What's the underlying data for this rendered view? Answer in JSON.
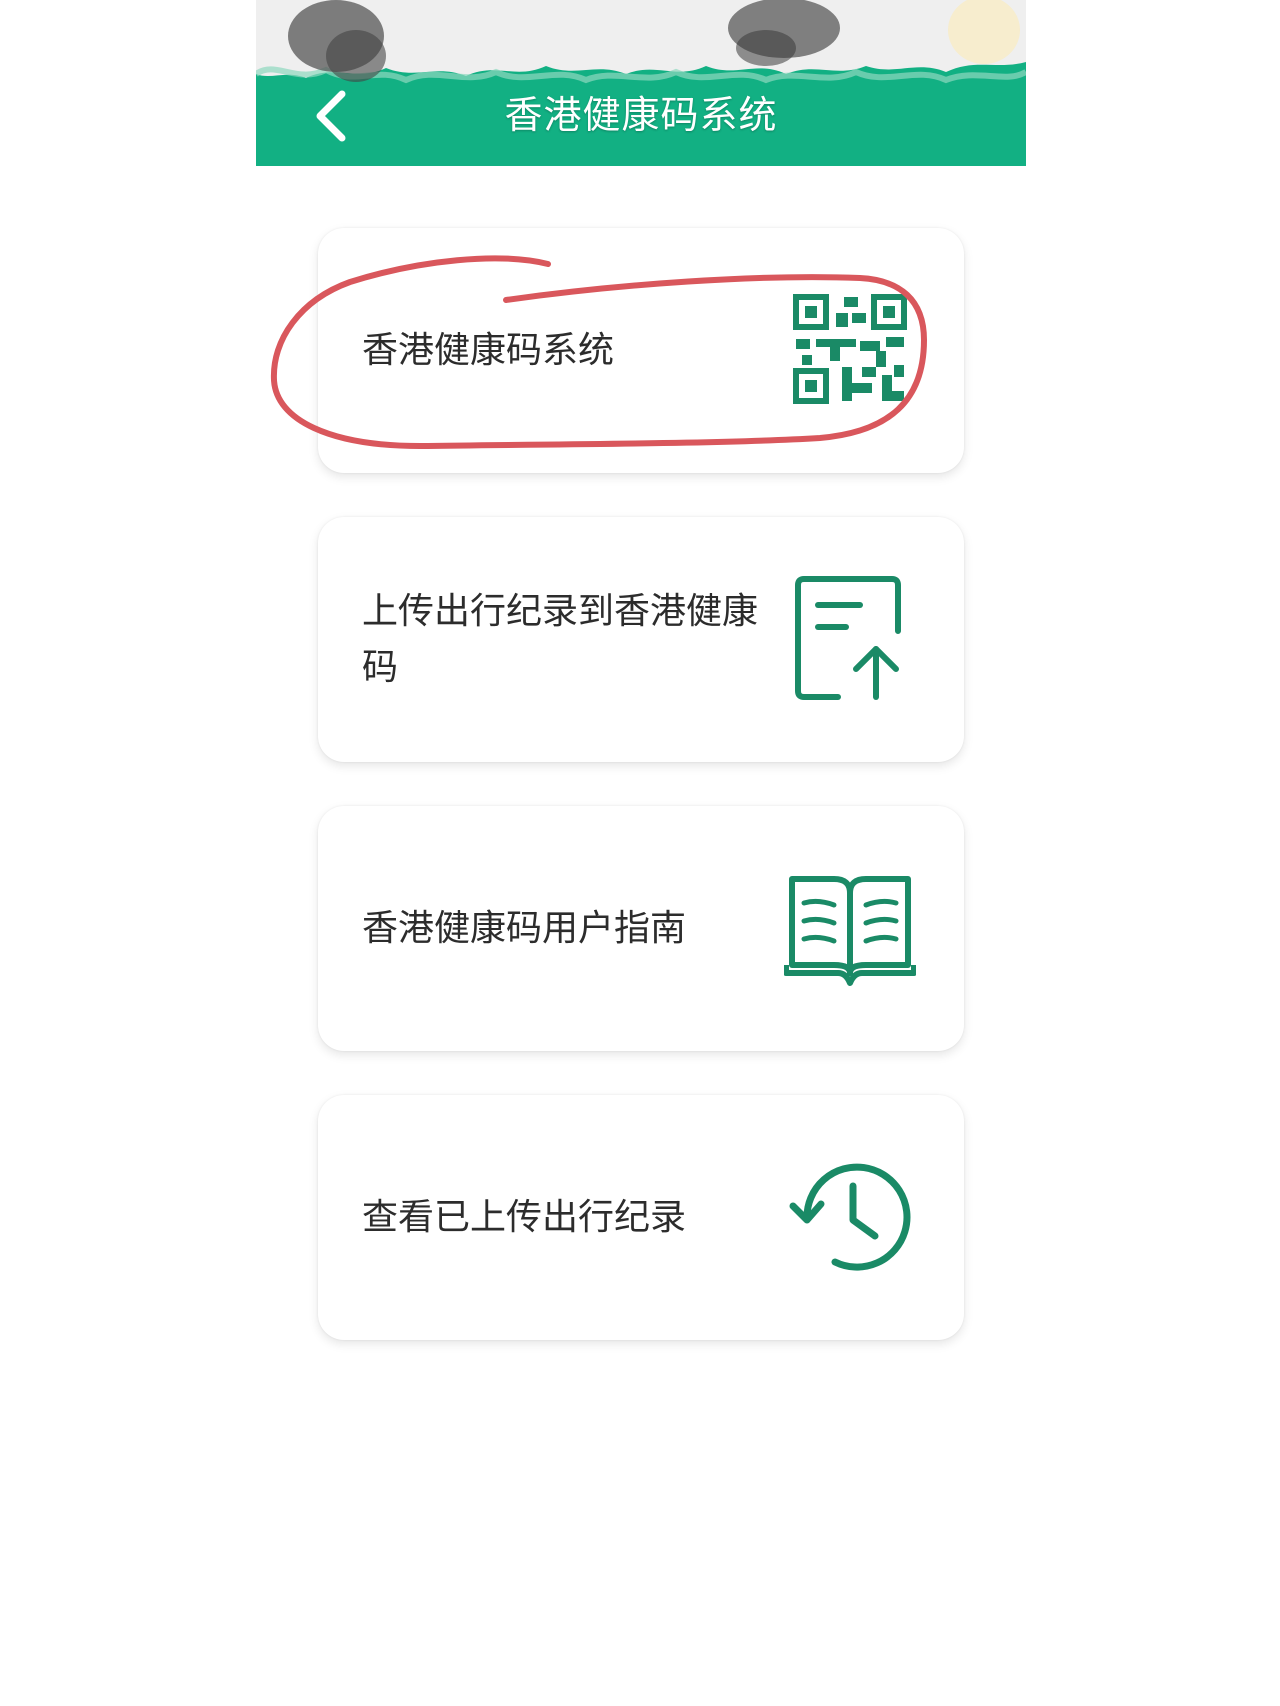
{
  "header": {
    "title": "香港健康码系统",
    "back_icon": "chevron-left-icon",
    "color": "#12b083"
  },
  "menu": {
    "items": [
      {
        "label": "香港健康码系统",
        "icon": "qr-code-icon"
      },
      {
        "label": "上传出行纪录到香港健康码",
        "icon": "document-upload-icon"
      },
      {
        "label": "香港健康码用户指南",
        "icon": "open-book-icon"
      },
      {
        "label": "查看已上传出行纪录",
        "icon": "history-clock-icon"
      }
    ]
  },
  "colors": {
    "accent": "#12b083",
    "icon": "#1a8a66",
    "annotation": "#d9575c"
  }
}
